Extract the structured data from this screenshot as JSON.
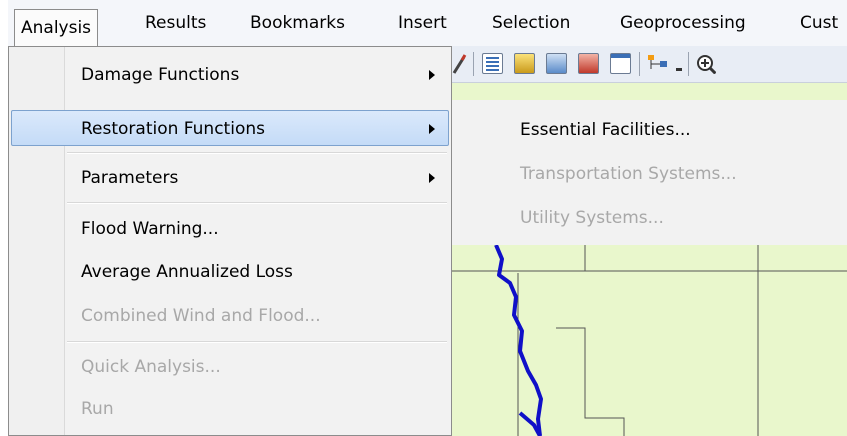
{
  "menubar": {
    "items": [
      {
        "label": "Analysis",
        "active": true
      },
      {
        "label": "Results"
      },
      {
        "label": "Bookmarks"
      },
      {
        "label": "Insert"
      },
      {
        "label": "Selection"
      },
      {
        "label": "Geoprocessing"
      },
      {
        "label": "Cust"
      }
    ]
  },
  "analysis_menu": {
    "items": [
      {
        "label": "Damage Functions",
        "submenu": true,
        "enabled": true
      },
      {
        "label": "Restoration Functions",
        "submenu": true,
        "enabled": true,
        "highlighted": true
      },
      {
        "label": "Parameters",
        "submenu": true,
        "enabled": true
      },
      {
        "label": "Flood Warning...",
        "enabled": true
      },
      {
        "label": "Average Annualized Loss",
        "enabled": true
      },
      {
        "label": "Combined Wind and Flood...",
        "enabled": false
      },
      {
        "label": "Quick Analysis...",
        "enabled": false
      },
      {
        "label": "Run",
        "enabled": false
      }
    ]
  },
  "restoration_submenu": {
    "items": [
      {
        "label": "Essential Facilities...",
        "enabled": true
      },
      {
        "label": "Transportation Systems...",
        "enabled": false
      },
      {
        "label": "Utility Systems...",
        "enabled": false
      }
    ]
  },
  "toolbar": {
    "icons": [
      "pencil-icon",
      "table-icon",
      "layer-icon",
      "globe-icon",
      "box-icon",
      "window-icon",
      "tree-icon",
      "overflow-icon",
      "zoom-in-icon"
    ]
  },
  "colors": {
    "highlight": "#c4dbf7",
    "map_fill": "#e9f7cc",
    "river": "#1010c8",
    "disabled_text": "#a8a8a8"
  }
}
